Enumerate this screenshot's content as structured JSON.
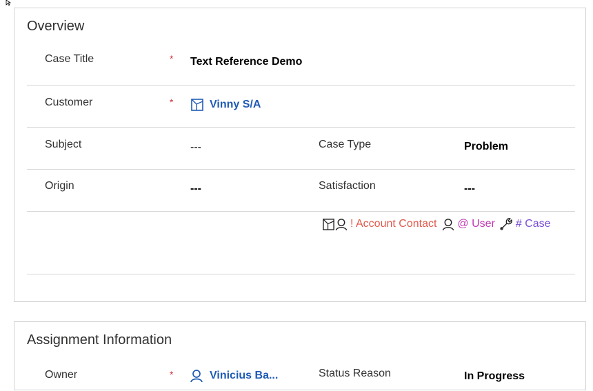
{
  "overview": {
    "title": "Overview",
    "required_mark": "*",
    "case_title": {
      "label": "Case Title",
      "value": "Text Reference Demo"
    },
    "customer": {
      "label": "Customer",
      "value": "Vinny S/A"
    },
    "subject": {
      "label": "Subject",
      "value": "---"
    },
    "case_type": {
      "label": "Case Type",
      "value": "Problem"
    },
    "origin": {
      "label": "Origin",
      "value": "---"
    },
    "satisfaction": {
      "label": "Satisfaction",
      "value": "---"
    },
    "references": {
      "account_contact": "! Account Contact",
      "user": "@ User",
      "case": "# Case"
    }
  },
  "assignment": {
    "title": "Assignment Information",
    "owner": {
      "label": "Owner",
      "value": "Vinicius Ba..."
    },
    "status_reason": {
      "label": "Status Reason",
      "value": "In Progress"
    }
  },
  "colors": {
    "link": "#1f5bb5",
    "required": "#d13438",
    "account_contact": "#e0584a",
    "user": "#c239b3",
    "case": "#7a4fd6"
  }
}
